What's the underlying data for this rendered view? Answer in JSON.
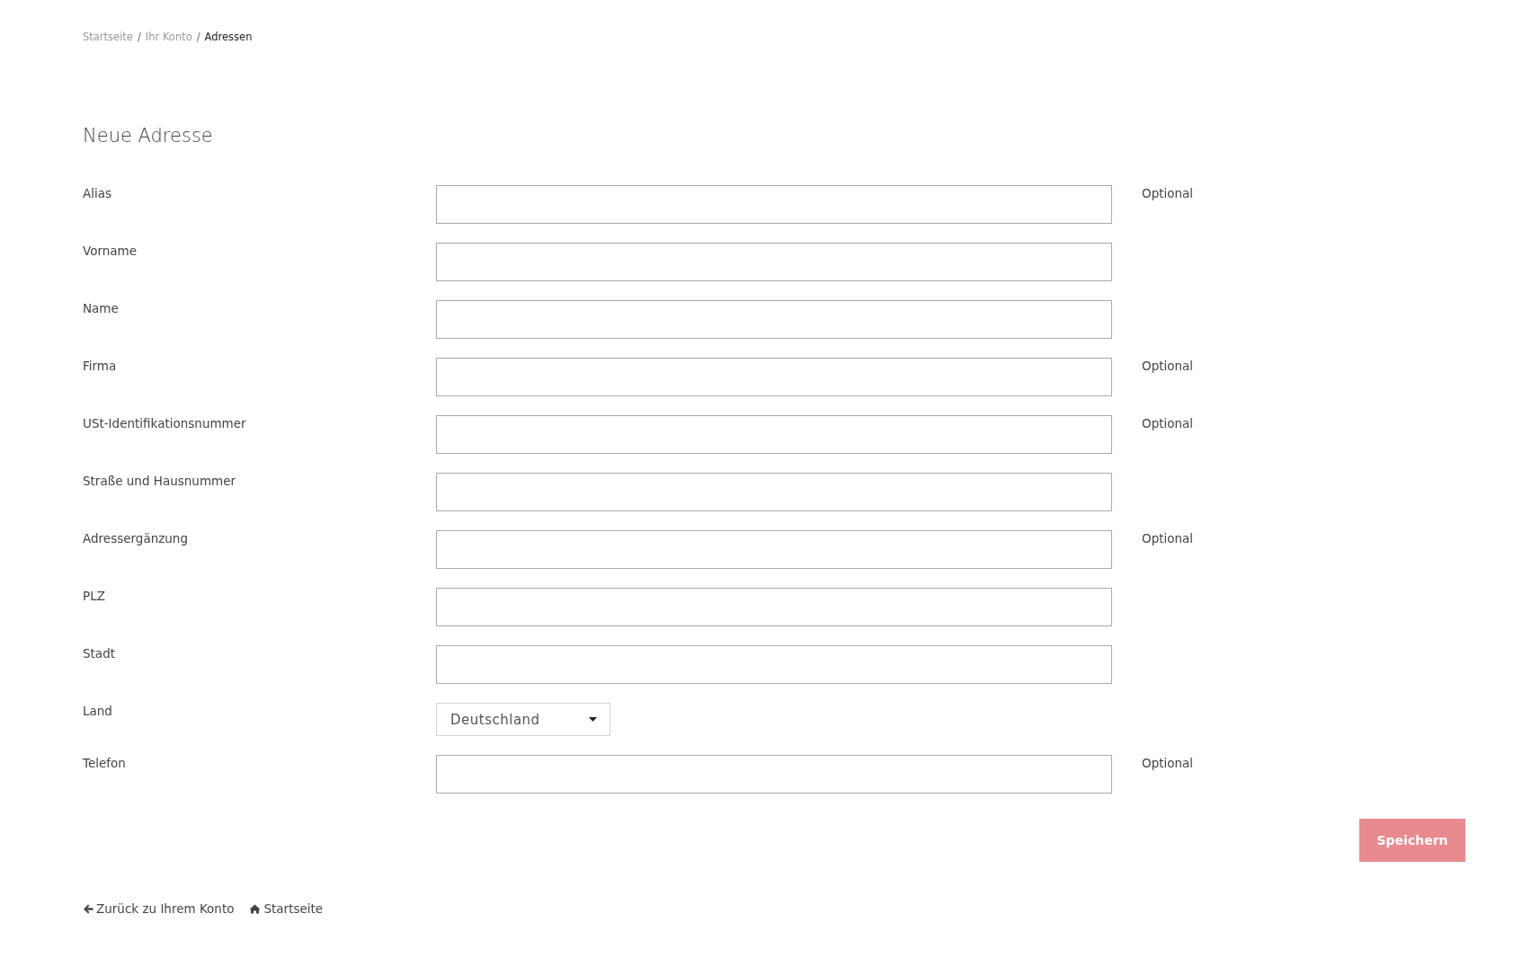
{
  "breadcrumb": [
    {
      "label": "Startseite",
      "current": false
    },
    {
      "label": "Ihr Konto",
      "current": false
    },
    {
      "label": "Adressen",
      "current": true
    }
  ],
  "breadcrumb_separator": "/",
  "title": "Neue Adresse",
  "fields": [
    {
      "kind": "text",
      "label": "Alias",
      "note": "Optional"
    },
    {
      "kind": "text",
      "label": "Vorname"
    },
    {
      "kind": "text",
      "label": "Name"
    },
    {
      "kind": "text",
      "label": "Firma",
      "note": "Optional"
    },
    {
      "kind": "text",
      "label": "USt-Identifikationsnummer",
      "note": "Optional"
    },
    {
      "kind": "text",
      "label": "Straße und Hausnummer"
    },
    {
      "kind": "text",
      "label": "Adressergänzung",
      "note": "Optional"
    },
    {
      "kind": "text",
      "label": "PLZ"
    },
    {
      "kind": "text",
      "label": "Stadt"
    },
    {
      "kind": "select",
      "label": "Land",
      "value": "Deutschland"
    },
    {
      "kind": "text",
      "label": "Telefon",
      "note": "Optional"
    }
  ],
  "submit": {
    "label": "Speichern",
    "disabled": true
  },
  "footer_links": [
    {
      "kind": "back",
      "label": "Zurück zu Ihrem Konto"
    },
    {
      "kind": "home",
      "label": "Startseite"
    }
  ]
}
